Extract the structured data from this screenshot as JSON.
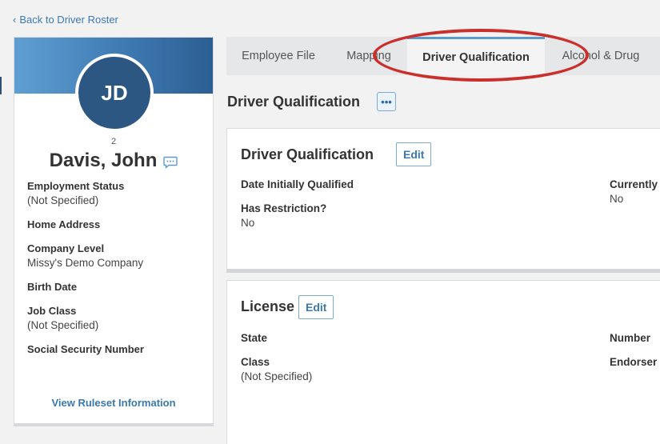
{
  "nav": {
    "back_label": "Back to Driver Roster"
  },
  "profile": {
    "initials": "JD",
    "employee_number": "2",
    "name": "Davis, John",
    "fields": [
      {
        "label": "Employment Status",
        "value": "(Not Specified)"
      },
      {
        "label": "Home Address",
        "value": ""
      },
      {
        "label": "Company Level",
        "value": "Missy's Demo Company"
      },
      {
        "label": "Birth Date",
        "value": ""
      },
      {
        "label": "Job Class",
        "value": "(Not Specified)"
      },
      {
        "label": "Social Security Number",
        "value": ""
      }
    ],
    "ruleset_link": "View Ruleset Information"
  },
  "tabs": [
    {
      "label": "Employee File"
    },
    {
      "label": "Mapping"
    },
    {
      "label": "Driver Qualification",
      "active": true
    },
    {
      "label": "Alcohol & Drug"
    }
  ],
  "main": {
    "title": "Driver Qualification",
    "more_label": "•••",
    "qualification": {
      "title": "Driver Qualification",
      "edit_label": "Edit",
      "date_qualified_label": "Date Initially Qualified",
      "date_qualified_value": "",
      "currently_label": "Currently",
      "currently_value": "No",
      "restriction_label": "Has Restriction?",
      "restriction_value": "No"
    },
    "license": {
      "title": "License",
      "edit_label": "Edit",
      "state_label": "State",
      "state_value": "",
      "number_label": "Number",
      "class_label": "Class",
      "class_value": "(Not Specified)",
      "endorsements_label": "Endorser"
    }
  },
  "colors": {
    "accent": "#3a78b0",
    "avatar": "#2c5782",
    "highlight": "#c9302c"
  }
}
